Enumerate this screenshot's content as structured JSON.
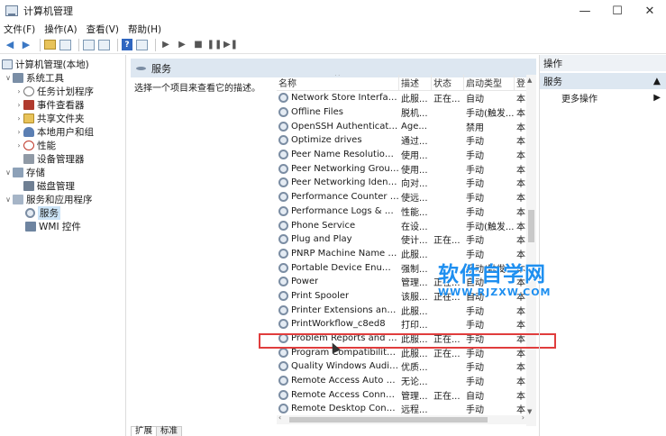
{
  "window": {
    "title": "计算机管理",
    "minimize": "—",
    "maximize": "☐",
    "close": "✕"
  },
  "menu": [
    "文件(F)",
    "操作(A)",
    "查看(V)",
    "帮助(H)"
  ],
  "tree": {
    "root": "计算机管理(本地)",
    "system_tools": "系统工具",
    "task_scheduler": "任务计划程序",
    "event_viewer": "事件查看器",
    "shared_folders": "共享文件夹",
    "local_users": "本地用户和组",
    "performance": "性能",
    "device_manager": "设备管理器",
    "storage": "存储",
    "disk_management": "磁盘管理",
    "services_apps": "服务和应用程序",
    "services": "服务",
    "wmi": "WMI 控件"
  },
  "services_panel": {
    "header": "服务",
    "hint": "选择一个项目来查看它的描述。",
    "columns": {
      "name": "名称",
      "desc": "描述",
      "status": "状态",
      "startup": "启动类型",
      "logon": "登"
    },
    "sort_indicator": "^",
    "rows": [
      {
        "name": "Network Store Interface ...",
        "desc": "此服...",
        "status": "正在...",
        "startup": "自动",
        "logon": "本"
      },
      {
        "name": "Offline Files",
        "desc": "脱机...",
        "status": "",
        "startup": "手动(触发...",
        "logon": "本"
      },
      {
        "name": "OpenSSH Authentication ...",
        "desc": "Age...",
        "status": "",
        "startup": "禁用",
        "logon": "本"
      },
      {
        "name": "Optimize drives",
        "desc": "通过...",
        "status": "",
        "startup": "手动",
        "logon": "本"
      },
      {
        "name": "Peer Name Resolution Pr...",
        "desc": "使用...",
        "status": "",
        "startup": "手动",
        "logon": "本"
      },
      {
        "name": "Peer Networking Groupi...",
        "desc": "使用...",
        "status": "",
        "startup": "手动",
        "logon": "本"
      },
      {
        "name": "Peer Networking Identity...",
        "desc": "向对...",
        "status": "",
        "startup": "手动",
        "logon": "本"
      },
      {
        "name": "Performance Counter DL...",
        "desc": "使远...",
        "status": "",
        "startup": "手动",
        "logon": "本"
      },
      {
        "name": "Performance Logs & Aler...",
        "desc": "性能...",
        "status": "",
        "startup": "手动",
        "logon": "本"
      },
      {
        "name": "Phone Service",
        "desc": "在设...",
        "status": "",
        "startup": "手动(触发...",
        "logon": "本"
      },
      {
        "name": "Plug and Play",
        "desc": "使计...",
        "status": "正在...",
        "startup": "手动",
        "logon": "本"
      },
      {
        "name": "PNRP Machine Name Pu...",
        "desc": "此服...",
        "status": "",
        "startup": "手动",
        "logon": "本"
      },
      {
        "name": "Portable Device Enumera...",
        "desc": "强制...",
        "status": "",
        "startup": "手动(触发...",
        "logon": "本"
      },
      {
        "name": "Power",
        "desc": "管理...",
        "status": "正在...",
        "startup": "自动",
        "logon": "本"
      },
      {
        "name": "Print Spooler",
        "desc": "该服...",
        "status": "正在...",
        "startup": "自动",
        "logon": "本"
      },
      {
        "name": "Printer Extensions and N...",
        "desc": "此服...",
        "status": "",
        "startup": "手动",
        "logon": "本"
      },
      {
        "name": "PrintWorkflow_c8ed8",
        "desc": "打印...",
        "status": "",
        "startup": "手动",
        "logon": "本"
      },
      {
        "name": "Problem Reports and Sol...",
        "desc": "此服...",
        "status": "正在...",
        "startup": "手动",
        "logon": "本"
      },
      {
        "name": "Program Compatibility A...",
        "desc": "此服...",
        "status": "正在...",
        "startup": "手动",
        "logon": "本"
      },
      {
        "name": "Quality Windows Audio V...",
        "desc": "优质...",
        "status": "",
        "startup": "手动",
        "logon": "本"
      },
      {
        "name": "Remote Access Auto Con...",
        "desc": "无论...",
        "status": "",
        "startup": "手动",
        "logon": "本"
      },
      {
        "name": "Remote Access Connecti...",
        "desc": "管理...",
        "status": "正在...",
        "startup": "自动",
        "logon": "本"
      },
      {
        "name": "Remote Desktop Configu...",
        "desc": "远程...",
        "status": "",
        "startup": "手动",
        "logon": "本"
      }
    ]
  },
  "tabs": [
    "扩展",
    "标准"
  ],
  "actions": {
    "title": "操作",
    "section": "服务",
    "more": "更多操作"
  },
  "watermark": {
    "big": "软件自学网",
    "small": "WWW.RJZXW.COM"
  }
}
